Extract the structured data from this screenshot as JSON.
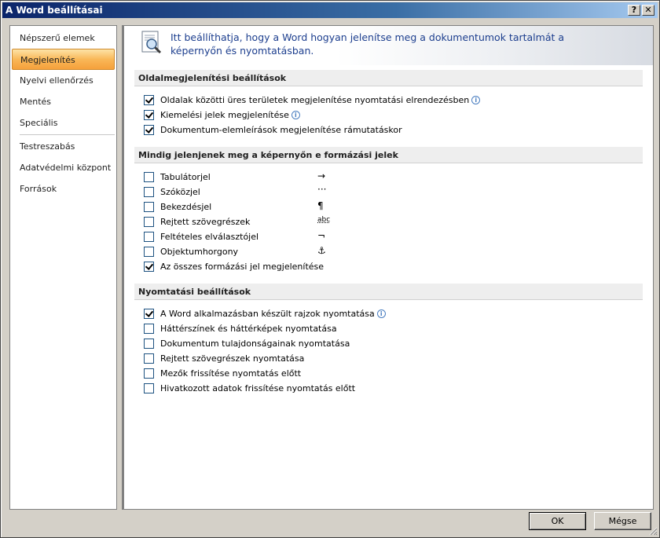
{
  "window": {
    "title": "A Word beállításai",
    "help_label": "?",
    "close_label": "✕"
  },
  "sidebar": {
    "group1": [
      {
        "label": "Népszerű elemek"
      },
      {
        "label": "Megjelenítés"
      },
      {
        "label": "Nyelvi ellenőrzés"
      },
      {
        "label": "Mentés"
      },
      {
        "label": "Speciális"
      }
    ],
    "group2": [
      {
        "label": "Testreszabás"
      },
      {
        "label": "Adatvédelmi központ"
      },
      {
        "label": "Források"
      }
    ],
    "selected": "Megjelenítés"
  },
  "header": {
    "text": "Itt beállíthatja, hogy a Word hogyan jelenítse meg a dokumentumok tartalmát a képernyőn és nyomtatásban.",
    "icon": "magnifier-page-icon"
  },
  "sections": [
    {
      "title": "Oldalmegjelenítési beállítások",
      "options": [
        {
          "label": "Oldalak közötti üres területek megjelenítése nyomtatási elrendezésben",
          "checked": true,
          "info": true
        },
        {
          "label": "Kiemelési jelek megjelenítése",
          "checked": true,
          "info": true
        },
        {
          "label": "Dokumentum-elemleírások megjelenítése rámutatáskor",
          "checked": true,
          "info": false
        }
      ]
    },
    {
      "title": "Mindig jelenjenek meg a képernyőn e formázási jelek",
      "options": [
        {
          "label": "Tabulátorjel",
          "checked": false,
          "mark": "→"
        },
        {
          "label": "Szóközjel",
          "checked": false,
          "mark": "···"
        },
        {
          "label": "Bekezdésjel",
          "checked": false,
          "mark": "¶"
        },
        {
          "label": "Rejtett szövegrészek",
          "checked": false,
          "mark": "abc"
        },
        {
          "label": "Feltételes elválasztójel",
          "checked": false,
          "mark": "¬"
        },
        {
          "label": "Objektumhorgony",
          "checked": false,
          "mark": "⚓"
        },
        {
          "label": "Az összes formázási jel megjelenítése",
          "checked": true
        }
      ]
    },
    {
      "title": "Nyomtatási beállítások",
      "options": [
        {
          "label": "A Word alkalmazásban készült rajzok nyomtatása",
          "checked": true,
          "info": true
        },
        {
          "label": "Háttérszínek és háttérképek nyomtatása",
          "checked": false
        },
        {
          "label": "Dokumentum tulajdonságainak nyomtatása",
          "checked": false
        },
        {
          "label": "Rejtett szövegrészek nyomtatása",
          "checked": false
        },
        {
          "label": "Mezők frissítése nyomtatás előtt",
          "checked": false
        },
        {
          "label": "Hivatkozott adatok frissítése nyomtatás előtt",
          "checked": false
        }
      ]
    }
  ],
  "buttons": {
    "ok": "OK",
    "cancel": "Mégse"
  },
  "colors": {
    "title_bar": "#0a246a",
    "selected_nav": "#f9b858",
    "header_text": "#1c3e8e",
    "section_bg": "#eeeeee"
  }
}
